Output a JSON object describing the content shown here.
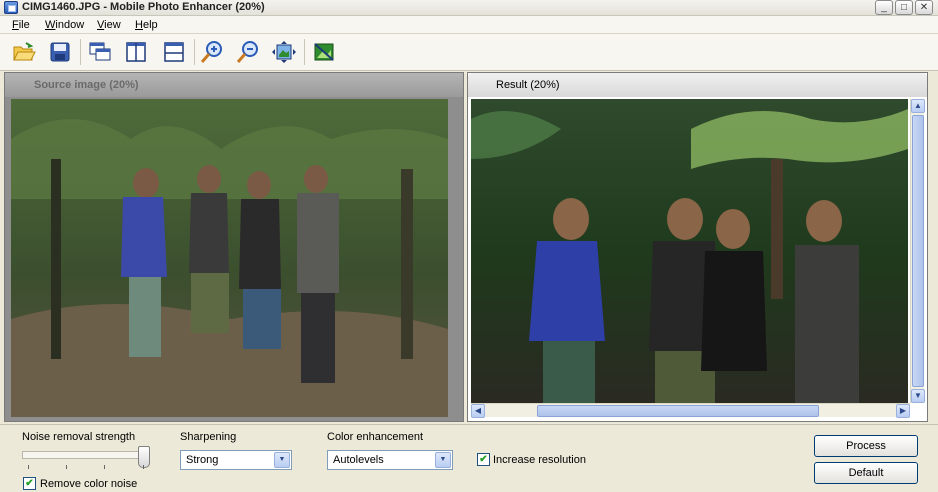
{
  "window": {
    "title": "CIMG1460.JPG - Mobile Photo Enhancer (20%)",
    "controls": {
      "minimize": "_",
      "maximize": "□",
      "close": "✕"
    }
  },
  "menu": [
    {
      "label": "File",
      "accel": "F",
      "rest": "ile"
    },
    {
      "label": "Window",
      "accel": "W",
      "rest": "indow"
    },
    {
      "label": "View",
      "accel": "V",
      "rest": "iew"
    },
    {
      "label": "Help",
      "accel": "H",
      "rest": "elp"
    }
  ],
  "toolbar": {
    "icons": [
      "open-folder-icon",
      "save-icon",
      "cascade-windows-icon",
      "tile-vertical-icon",
      "tile-horizontal-icon",
      "zoom-in-icon",
      "zoom-out-icon",
      "fit-to-window-icon",
      "enhance-image-icon"
    ]
  },
  "source_pane": {
    "title": "Source image (20%)"
  },
  "result_pane": {
    "title": "Result (20%)"
  },
  "scroll": {
    "up": "▲",
    "down": "▼",
    "left": "◀",
    "right": "▶"
  },
  "controls": {
    "noise_label": "Noise removal strength",
    "noise_level": 1.0,
    "remove_color_noise_label": "Remove color noise",
    "remove_color_noise_checked": true,
    "sharpening_label": "Sharpening",
    "sharpening_value": "Strong",
    "color_label": "Color enhancement",
    "color_value": "Autolevels",
    "increase_resolution_label": "Increase resolution",
    "increase_resolution_checked": true,
    "check_mark": "✔",
    "drop_arrow": "▼",
    "process_button": "Process",
    "default_button": "Default"
  },
  "colors": {
    "accent": "#0a246a",
    "button_border": "#003c74",
    "foliage_dark": "#1f3a1c",
    "foliage_light": "#6f9a52"
  }
}
